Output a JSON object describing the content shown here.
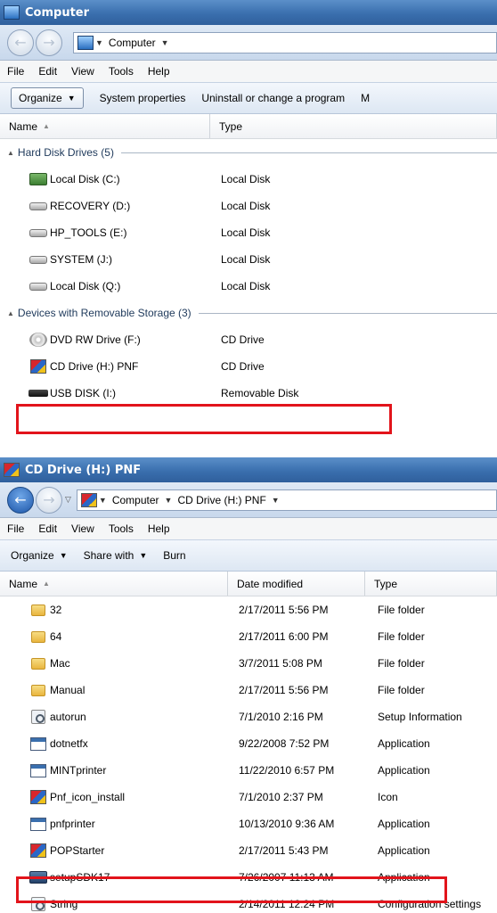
{
  "window1": {
    "title": "Computer",
    "address": [
      "Computer"
    ],
    "menu": [
      "File",
      "Edit",
      "View",
      "Tools",
      "Help"
    ],
    "commands": [
      "Organize",
      "System properties",
      "Uninstall or change a program",
      "M"
    ],
    "columns": [
      "Name",
      "Type"
    ],
    "groups": [
      {
        "header": "Hard Disk Drives (5)",
        "items": [
          {
            "name": "Local Disk (C:)",
            "type": "Local Disk",
            "icon": "system-drive-icon"
          },
          {
            "name": "RECOVERY (D:)",
            "type": "Local Disk",
            "icon": "drive-icon"
          },
          {
            "name": "HP_TOOLS (E:)",
            "type": "Local Disk",
            "icon": "drive-icon"
          },
          {
            "name": "SYSTEM (J:)",
            "type": "Local Disk",
            "icon": "drive-icon"
          },
          {
            "name": "Local Disk (Q:)",
            "type": "Local Disk",
            "icon": "drive-icon"
          }
        ]
      },
      {
        "header": "Devices with Removable Storage (3)",
        "items": [
          {
            "name": "DVD RW Drive (F:)",
            "type": "CD Drive",
            "icon": "dvd-drive-icon"
          },
          {
            "name": "CD Drive (H:) PNF",
            "type": "CD Drive",
            "icon": "pnf-icon",
            "highlighted": true
          },
          {
            "name": "USB DISK (I:)",
            "type": "Removable Disk",
            "icon": "usb-drive-icon"
          }
        ]
      }
    ]
  },
  "window2": {
    "title": "CD Drive (H:) PNF",
    "address": [
      "Computer",
      "CD Drive (H:) PNF"
    ],
    "menu": [
      "File",
      "Edit",
      "View",
      "Tools",
      "Help"
    ],
    "commands": [
      "Organize",
      "Share with",
      "Burn"
    ],
    "columns": [
      "Name",
      "Date modified",
      "Type"
    ],
    "files": [
      {
        "name": "32",
        "date": "2/17/2011 5:56 PM",
        "type": "File folder",
        "icon": "folder-icon"
      },
      {
        "name": "64",
        "date": "2/17/2011 6:00 PM",
        "type": "File folder",
        "icon": "folder-icon"
      },
      {
        "name": "Mac",
        "date": "3/7/2011 5:08 PM",
        "type": "File folder",
        "icon": "folder-icon"
      },
      {
        "name": "Manual",
        "date": "2/17/2011 5:56 PM",
        "type": "File folder",
        "icon": "folder-icon"
      },
      {
        "name": "autorun",
        "date": "7/1/2010 2:16 PM",
        "type": "Setup Information",
        "icon": "settings-file-icon"
      },
      {
        "name": "dotnetfx",
        "date": "9/22/2008 7:52 PM",
        "type": "Application",
        "icon": "application-icon"
      },
      {
        "name": "MINTprinter",
        "date": "11/22/2010 6:57 PM",
        "type": "Application",
        "icon": "application-icon"
      },
      {
        "name": "Pnf_icon_install",
        "date": "7/1/2010 2:37 PM",
        "type": "Icon",
        "icon": "pnf-icon"
      },
      {
        "name": "pnfprinter",
        "date": "10/13/2010 9:36 AM",
        "type": "Application",
        "icon": "application-icon"
      },
      {
        "name": "POPStarter",
        "date": "2/17/2011 5:43 PM",
        "type": "Application",
        "icon": "pnf-icon",
        "highlighted": true
      },
      {
        "name": "setupSDK17",
        "date": "7/26/2007 11:13 AM",
        "type": "Application",
        "icon": "sdk-icon"
      },
      {
        "name": "String",
        "date": "2/14/2011 12:24 PM",
        "type": "Configuration settings",
        "icon": "settings-file-icon"
      }
    ]
  },
  "colors": {
    "highlight": "#e2141b",
    "titlebar": "#3a6fae"
  }
}
